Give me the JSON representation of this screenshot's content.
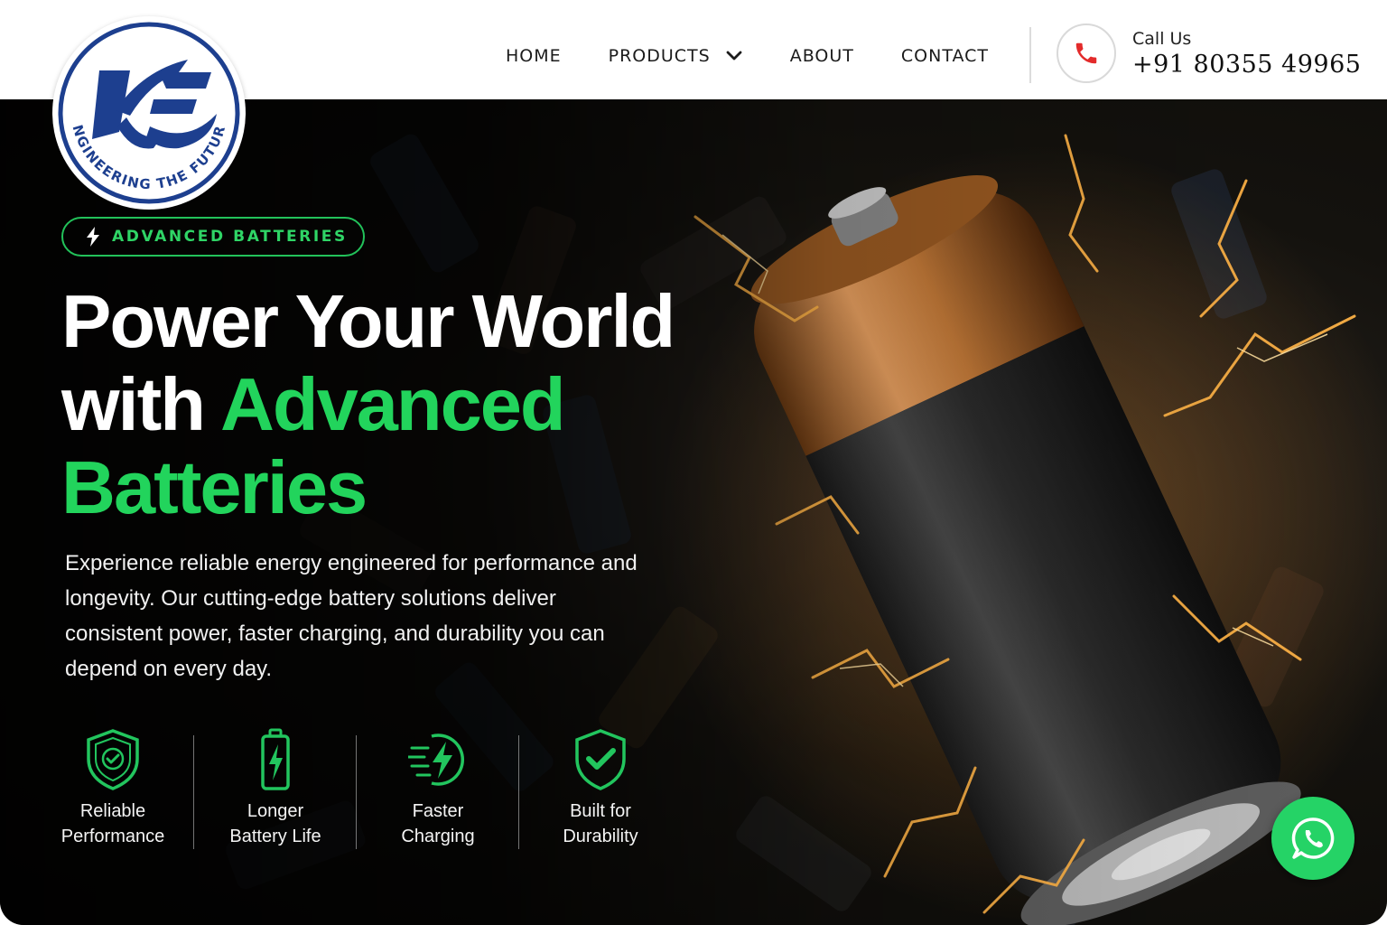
{
  "brand": {
    "logo_initials": "KE",
    "logo_tagline": "ENGINEERING THE FUTURE",
    "primary_color": "#1d3f8f",
    "accent_color": "#22d45c"
  },
  "nav": {
    "items": [
      {
        "label": "HOME"
      },
      {
        "label": "PRODUCTS",
        "has_dropdown": true,
        "icon": "chevron-down-icon"
      },
      {
        "label": "ABOUT"
      },
      {
        "label": "CONTACT"
      }
    ]
  },
  "contact": {
    "label": "Call Us",
    "phone": "+91 80355 49965",
    "icon": "phone-icon",
    "icon_color": "#e32b2b"
  },
  "hero": {
    "badge": "ADVANCED BATTERIES",
    "badge_icon": "lightning-icon",
    "headline_line1": "Power Your World",
    "headline_with": "with ",
    "headline_highlight_1": "Advanced",
    "headline_highlight_2": "Batteries",
    "description": "Experience reliable energy engineered for performance and longevity. Our cutting-edge battery solutions deliver consistent power, faster charging, and durability you can depend on every day.",
    "features": [
      {
        "line1": "Reliable",
        "line2": "Performance",
        "icon": "shield-check-icon"
      },
      {
        "line1": "Longer",
        "line2": "Battery Life",
        "icon": "battery-bolt-icon"
      },
      {
        "line1": "Faster",
        "line2": "Charging",
        "icon": "fast-charge-icon"
      },
      {
        "line1": "Built for",
        "line2": "Durability",
        "icon": "shield-check-filled-icon"
      }
    ]
  },
  "whatsapp": {
    "icon": "whatsapp-icon",
    "color": "#25d366"
  }
}
